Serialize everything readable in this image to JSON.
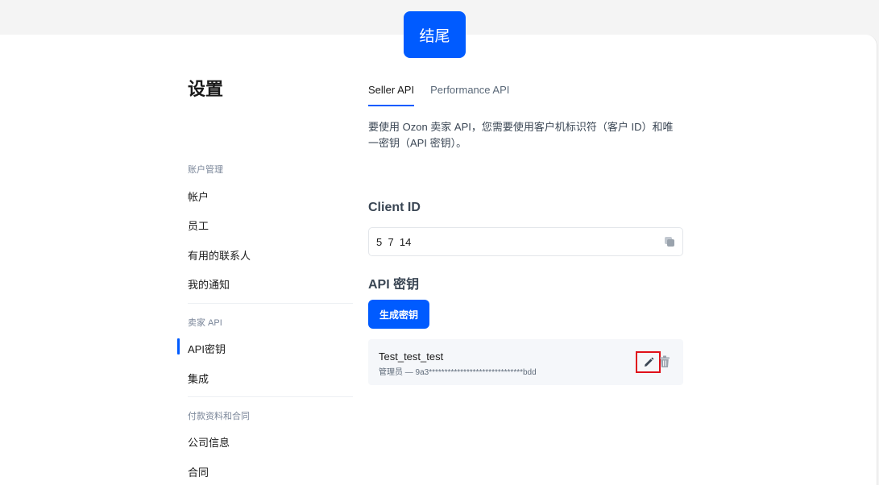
{
  "finish_button": "结尾",
  "sidebar": {
    "title": "设置",
    "groups": [
      {
        "label": "账户管理",
        "items": [
          "帐户",
          "员工",
          "有用的联系人",
          "我的通知"
        ]
      },
      {
        "label": "卖家 API",
        "items": [
          "API密钥",
          "集成"
        ]
      },
      {
        "label": "付款资料和合同",
        "items": [
          "公司信息",
          "合同"
        ]
      }
    ],
    "active_item": "API密钥"
  },
  "tabs": [
    {
      "label": "Seller API",
      "active": true
    },
    {
      "label": "Performance API",
      "active": false
    }
  ],
  "description": "要使用 Ozon 卖家 API，您需要使用客户机标识符（客户 ID）和唯一密钥（API 密钥）。",
  "client_id": {
    "heading": "Client ID",
    "value": "5  7  14",
    "icon": "copy-icon"
  },
  "api_keys": {
    "heading": "API 密钥",
    "generate_button": "生成密钥",
    "keys": [
      {
        "name": "Test_test_test",
        "meta": "管理员 — 9a3******************************bdd"
      }
    ]
  },
  "colors": {
    "accent": "#005bff",
    "highlight_border": "#e0101a"
  }
}
